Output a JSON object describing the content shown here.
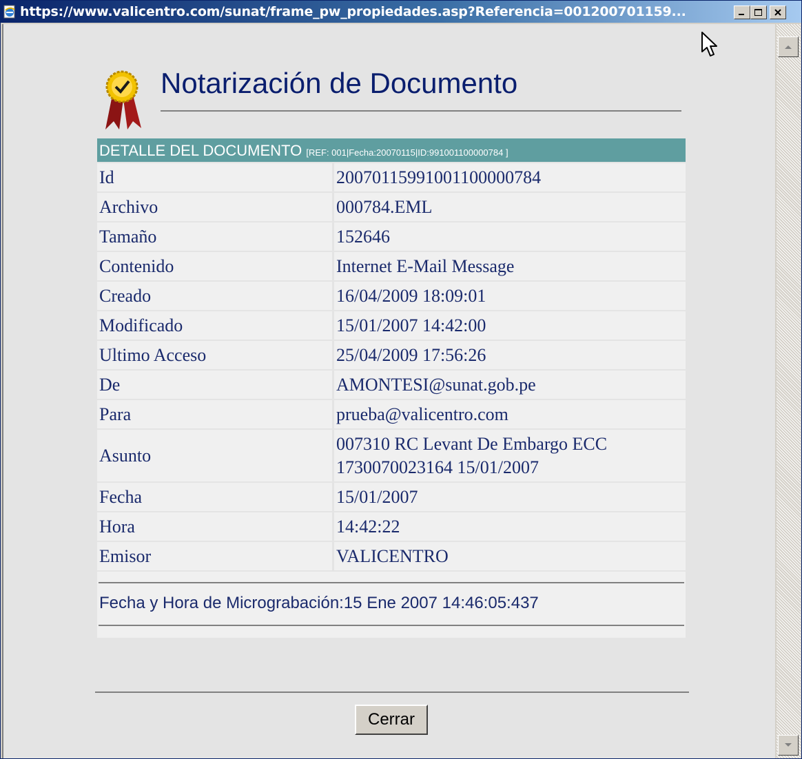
{
  "window": {
    "title": "https://www.valicentro.com/sunat/frame_pw_propiedades.asp?Referencia=001200701159..."
  },
  "page": {
    "title": "Notarización de Documento"
  },
  "detail": {
    "header_label": "DETALLE DEL DOCUMENTO",
    "header_ref": "[REF: 001|Fecha:20070115|ID:991001100000784 ]",
    "rows": [
      {
        "label": "Id",
        "value": "20070115991001100000784"
      },
      {
        "label": "Archivo",
        "value": "000784.EML"
      },
      {
        "label": "Tamaño",
        "value": "152646"
      },
      {
        "label": "Contenido",
        "value": "Internet E-Mail Message"
      },
      {
        "label": "Creado",
        "value": "16/04/2009 18:09:01"
      },
      {
        "label": "Modificado",
        "value": "15/01/2007 14:42:00"
      },
      {
        "label": "Ultimo Acceso",
        "value": "25/04/2009 17:56:26"
      },
      {
        "label": "De",
        "value": "AMONTESI@sunat.gob.pe"
      },
      {
        "label": "Para",
        "value": "prueba@valicentro.com"
      },
      {
        "label": "Asunto",
        "value": "007310 RC Levant De Embargo ECC",
        "value2": "1730070023164 15/01/2007"
      },
      {
        "label": "Fecha",
        "value": "15/01/2007"
      },
      {
        "label": "Hora",
        "value": "14:42:22"
      },
      {
        "label": "Emisor",
        "value": "VALICENTRO"
      }
    ],
    "micrograbacion": "Fecha y Hora de Micrograbación:15 Ene 2007 14:46:05:437"
  },
  "buttons": {
    "close_label": "Cerrar"
  },
  "icons": {
    "browser": "ie-page-icon",
    "award": "award-ribbon-icon",
    "minimize": "minimize-icon",
    "maximize": "maximize-icon",
    "close": "close-icon",
    "scroll_up": "scroll-up-arrow-icon",
    "scroll_down": "scroll-down-arrow-icon",
    "cursor": "mouse-pointer-icon"
  }
}
